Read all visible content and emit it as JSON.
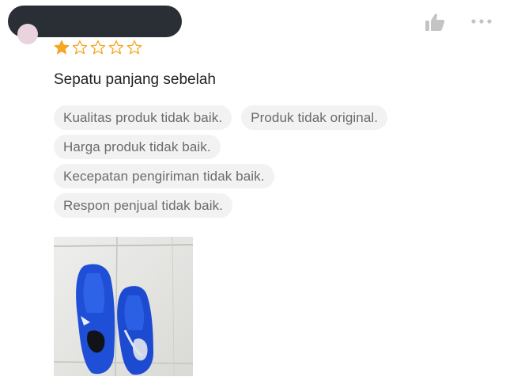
{
  "review": {
    "rating": 1,
    "rating_max": 5,
    "title": "Sepatu panjang sebelah",
    "tags": [
      "Kualitas produk tidak baik.",
      "Produk tidak original.",
      "Harga produk tidak baik.",
      "Kecepatan pengiriman tidak baik.",
      "Respon penjual tidak baik."
    ],
    "photo": {
      "icon": "shoes-photo-icon"
    }
  },
  "header": {
    "like_icon": "thumbs-up-icon",
    "more_icon": "more-options-icon"
  },
  "colors": {
    "star_filled": "#f5a623",
    "star_empty_stroke": "#f5a623",
    "tag_bg": "#f2f2f2",
    "tag_text": "#6b6b6b",
    "redaction": "#2a2f36"
  }
}
